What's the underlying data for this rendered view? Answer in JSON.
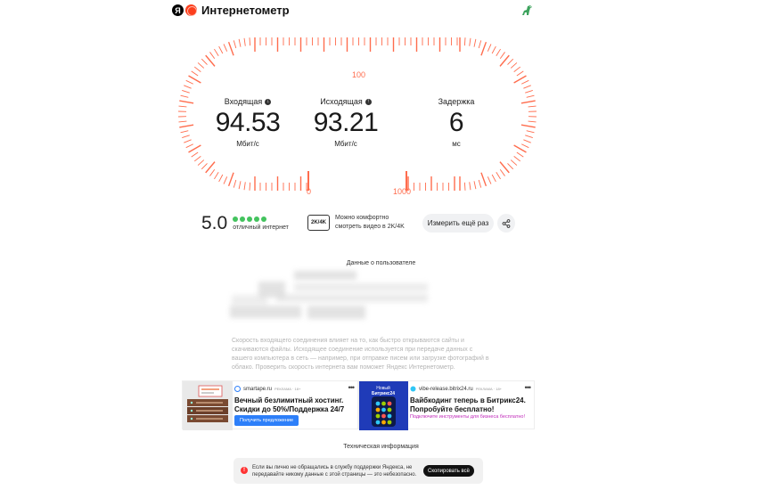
{
  "header": {
    "ya": "Я",
    "title": "Интернетометр"
  },
  "gauge": {
    "scale_labels": [
      "100",
      "0",
      "1000"
    ],
    "accent_color": "#ff6c4d"
  },
  "metrics": [
    {
      "label": "Входящая",
      "value": "94.53",
      "unit": "Мбит/с"
    },
    {
      "label": "Исходящая",
      "value": "93.21",
      "unit": "Мбит/с"
    },
    {
      "label": "Задержка",
      "value": "6",
      "unit": "мс"
    }
  ],
  "rating": {
    "score": "5.0",
    "dots": 5,
    "description": "отличный интернет",
    "dot_color": "#43c35e"
  },
  "quality": {
    "badge": "2K/4K",
    "line1": "Можно комфортно",
    "line2": "смотреть видео в 2K/4K"
  },
  "actions": {
    "retest": "Измерить ещё раз",
    "share_icon": "share-icon"
  },
  "user_data": {
    "title": "Данные о пользователе"
  },
  "note": "Скорость входящего соединения влияет на то, как быстро открываются сайты и скачиваются файлы. Исходящее соединение используется при передаче данных с вашего компьютера в сеть — например, при отправке писем или загрузке фотографий в облако. Проверить скорость интернета вам поможет Яндекс Интернетометр.",
  "ads": [
    {
      "source": "smartape.ru",
      "tag": "РЕКЛАМА · 18+",
      "more": "•••",
      "headline_line1": "Вечный безлимитный хостинг.",
      "headline_line2": "Скидки до 50%/Поддержка 24/7",
      "cta": "Получить предложение"
    },
    {
      "source": "vibe-release.bitrix24.ru",
      "tag": "РЕКЛАМА · 18+",
      "more": "•••",
      "image_line1": "Новый",
      "image_line2": "Битрикс24",
      "headline_line1": "Вайбкодинг теперь в Битрикс24.",
      "headline_line2": "Попробуйте бесплатно!",
      "sub": "Подключите инструменты для бизнеса бесплатно!"
    }
  ],
  "tech": {
    "title": "Техническая информация",
    "text": "Если вы лично не обращались в службу поддержки Яндекса, не передавайте никому данные с этой страницы — это небезопасно.",
    "copy_button": "Скопировать всё"
  }
}
